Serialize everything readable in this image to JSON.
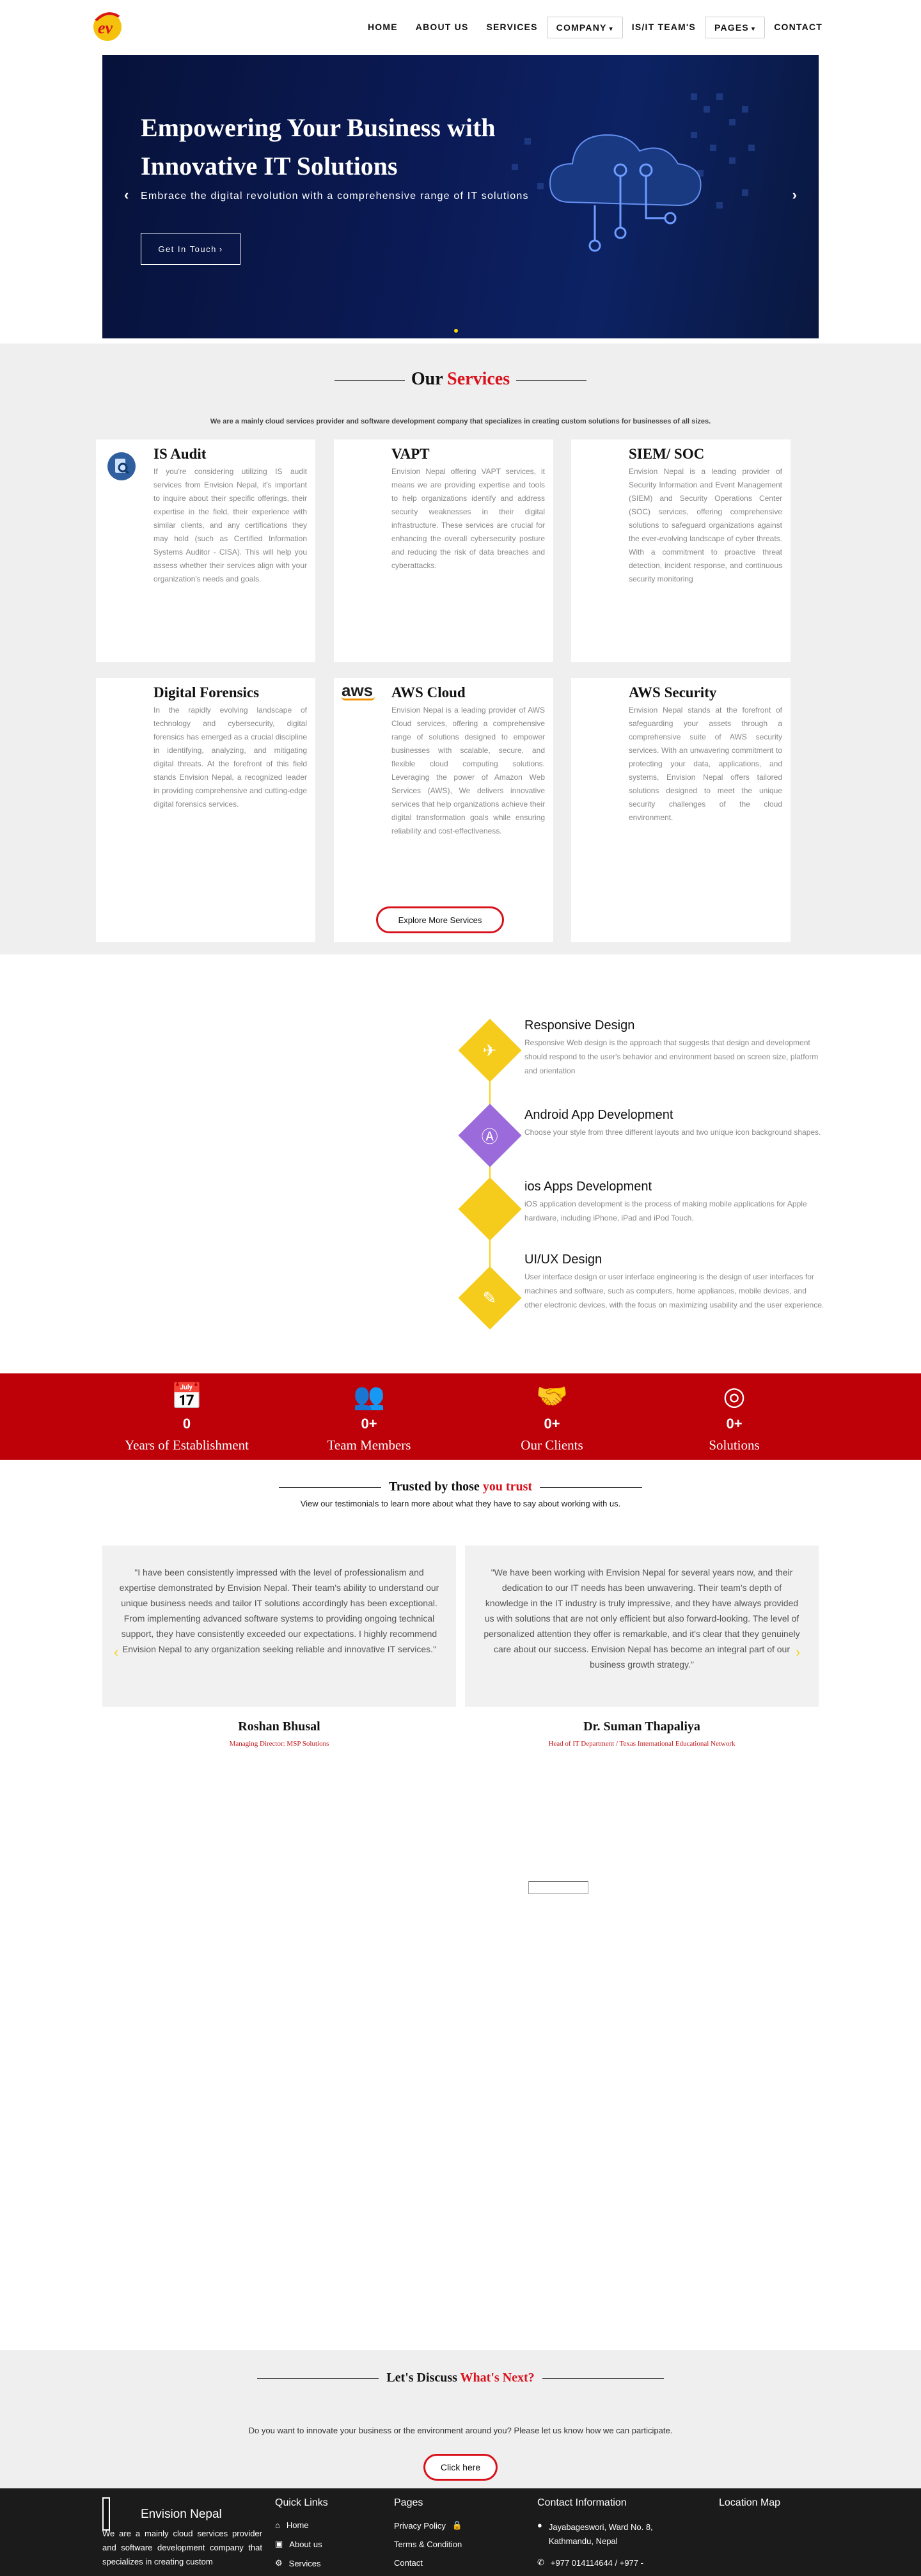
{
  "nav": {
    "logo_text": "ev",
    "items": [
      {
        "label": "HOME"
      },
      {
        "label": "ABOUT US"
      },
      {
        "label": "SERVICES"
      },
      {
        "label": "COMPANY"
      },
      {
        "label": "IS/IT TEAM'S"
      },
      {
        "label": "PAGES"
      },
      {
        "label": "CONTACT"
      }
    ]
  },
  "hero": {
    "title": "Empowering Your Business with Innovative IT Solutions",
    "subtitle": "Embrace the digital revolution with a comprehensive range of IT solutions",
    "cta": "Get In Touch",
    "prev": "‹",
    "next": "›"
  },
  "services": {
    "title_a": "Our",
    "title_b": "Services",
    "description": "We are a mainly cloud services provider and software development company that specializes in creating custom solutions for businesses of all sizes.",
    "cards": [
      {
        "title": "IS Audit",
        "text": "If you're considering utilizing IS audit services from Envision Nepal, it's important to inquire about their specific offerings, their expertise in the field, their experience with similar clients, and any certifications they may hold (such as Certified Information Systems Auditor - CISA). This will help you assess whether their services align with your organization's needs and goals."
      },
      {
        "title": "VAPT",
        "text": "Envision Nepal offering VAPT services, it means we are providing expertise and tools to help organizations identify and address security weaknesses in their digital infrastructure. These services are crucial for enhancing the overall cybersecurity posture and reducing the risk of data breaches and cyberattacks."
      },
      {
        "title": "SIEM/ SOC",
        "text": "Envision Nepal is a leading provider of Security Information and Event Management (SIEM) and Security Operations Center (SOC) services, offering comprehensive solutions to safeguard organizations against the ever-evolving landscape of cyber threats. With a commitment to proactive threat detection, incident response, and continuous security monitoring"
      },
      {
        "title": "Digital Forensics",
        "text": "In the rapidly evolving landscape of technology and cybersecurity, digital forensics has emerged as a crucial discipline in identifying, analyzing, and mitigating digital threats. At the forefront of this field stands Envision Nepal, a recognized leader in providing comprehensive and cutting-edge digital forensics services."
      },
      {
        "title": "AWS Cloud",
        "text": "Envision Nepal is a leading provider of AWS Cloud services, offering a comprehensive range of solutions designed to empower businesses with scalable, secure, and flexible cloud computing solutions. Leveraging the power of Amazon Web Services (AWS), We delivers innovative services that help organizations achieve their digital transformation goals while ensuring reliability and cost-effectiveness."
      },
      {
        "title": "AWS Security",
        "text": "Envision Nepal stands at the forefront of safeguarding your assets through a comprehensive suite of AWS security services. With an unwavering commitment to protecting your data, applications, and systems, Envision Nepal offers tailored solutions designed to meet the unique security challenges of the cloud environment."
      }
    ],
    "aws_logo": "aws",
    "explore": "Explore More Services"
  },
  "features": [
    {
      "title": "Responsive Design",
      "text": "Responsive Web design is the approach that suggests that design and development should respond to the user's behavior and environment based on screen size, platform and orientation",
      "icon": "rocket-icon",
      "color": "#f5cc1c"
    },
    {
      "title": "Android App Development",
      "text": "Choose your style from three different layouts and two unique icon background shapes.",
      "icon": "app-store-icon",
      "color": "#9b6bdb"
    },
    {
      "title": "ios Apps Development",
      "text": "iOS application development is the process of making mobile applications for Apple hardware, including iPhone, iPad and iPod Touch.",
      "icon": "apple-icon",
      "color": "#f5cc1c"
    },
    {
      "title": "UI/UX Design",
      "text": "User interface design or user interface engineering is the design of user interfaces for machines and software, such as computers, home appliances, mobile devices, and other electronic devices, with the focus on maximizing usability and the user experience.",
      "icon": "brush-icon",
      "color": "#f5cc1c"
    }
  ],
  "stats": [
    {
      "value": "0",
      "label": "Years of Establishment",
      "icon": "calendar-icon"
    },
    {
      "value": "0+",
      "label": "Team Members",
      "icon": "users-icon"
    },
    {
      "value": "0+",
      "label": "Our Clients",
      "icon": "handshake-icon"
    },
    {
      "value": "0+",
      "label": "Solutions",
      "icon": "target-icon"
    }
  ],
  "testimonials": {
    "title_a": "Trusted by those",
    "title_b": "you trust",
    "subtitle": "View our testimonials to learn more about what they have to say about working with us.",
    "items": [
      {
        "quote": "\"I have been consistently impressed with the level of professionalism and expertise demonstrated by Envision Nepal. Their team's ability to understand our unique business needs and tailor IT solutions accordingly has been exceptional. From implementing advanced software systems to providing ongoing technical support, they have consistently exceeded our expectations. I highly recommend Envision Nepal to any organization seeking reliable and innovative IT services.\"",
        "name": "Roshan Bhusal",
        "role": "Managing Director: MSP Solutions"
      },
      {
        "quote": "\"We have been working with Envision Nepal for several years now, and their dedication to our IT needs has been unwavering. Their team's depth of knowledge in the IT industry is truly impressive, and they have always provided us with solutions that are not only efficient but also forward-looking. The level of personalized attention they offer is remarkable, and it's clear that they genuinely care about our success. Envision Nepal has become an integral part of our business growth strategy.\"",
        "name": "Dr. Suman Thapaliya",
        "role": "Head of IT Department / Texas International Educational Network"
      }
    ]
  },
  "contact_cta": {
    "title_a": "Let's Discuss",
    "title_b": "What's Next?",
    "text": "Do you want to innovate your business or the environment around you? Please let us know how we can participate.",
    "button": "Click here"
  },
  "footer": {
    "brand": "Envision Nepal",
    "brand_text": "We are a mainly cloud services provider and software development company that specializes in creating custom",
    "quick_links_title": "Quick Links",
    "quick_links": [
      "Home",
      "About us",
      "Services"
    ],
    "pages_title": "Pages",
    "pages": [
      "Privacy Policy",
      "Terms & Condition",
      "Contact"
    ],
    "contact_title": "Contact Information",
    "address": "Jayabageswori, Ward No. 8, Kathmandu, Nepal",
    "phone": "+977 014114644 / +977 -",
    "map_title": "Location Map"
  },
  "colors": {
    "accent": "#d9121c",
    "stats_bg": "#be0008",
    "yellow": "#f5cc1c"
  }
}
